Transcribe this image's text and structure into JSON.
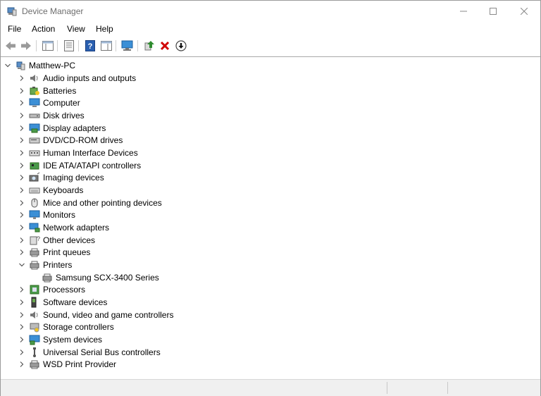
{
  "window": {
    "title": "Device Manager"
  },
  "menu": [
    "File",
    "Action",
    "View",
    "Help"
  ],
  "tree": {
    "root": "Matthew-PC",
    "categories": [
      {
        "label": "Audio inputs and outputs",
        "icon": "speaker-icon"
      },
      {
        "label": "Batteries",
        "icon": "battery-icon"
      },
      {
        "label": "Computer",
        "icon": "computer-icon"
      },
      {
        "label": "Disk drives",
        "icon": "disk-drive-icon"
      },
      {
        "label": "Display adapters",
        "icon": "display-adapter-icon"
      },
      {
        "label": "DVD/CD-ROM drives",
        "icon": "dvd-drive-icon"
      },
      {
        "label": "Human Interface Devices",
        "icon": "hid-icon"
      },
      {
        "label": "IDE ATA/ATAPI controllers",
        "icon": "ide-controller-icon"
      },
      {
        "label": "Imaging devices",
        "icon": "camera-icon"
      },
      {
        "label": "Keyboards",
        "icon": "keyboard-icon"
      },
      {
        "label": "Mice and other pointing devices",
        "icon": "mouse-icon"
      },
      {
        "label": "Monitors",
        "icon": "monitor-icon"
      },
      {
        "label": "Network adapters",
        "icon": "network-adapter-icon"
      },
      {
        "label": "Other devices",
        "icon": "unknown-device-icon"
      },
      {
        "label": "Print queues",
        "icon": "print-queue-icon"
      },
      {
        "label": "Printers",
        "icon": "printer-icon",
        "expanded": true,
        "children": [
          {
            "label": "Samsung SCX-3400 Series",
            "icon": "printer-icon"
          }
        ]
      },
      {
        "label": "Processors",
        "icon": "processor-icon"
      },
      {
        "label": "Software devices",
        "icon": "software-device-icon"
      },
      {
        "label": "Sound, video and game controllers",
        "icon": "sound-controller-icon"
      },
      {
        "label": "Storage controllers",
        "icon": "storage-controller-icon"
      },
      {
        "label": "System devices",
        "icon": "system-device-icon"
      },
      {
        "label": "Universal Serial Bus controllers",
        "icon": "usb-icon"
      },
      {
        "label": "WSD Print Provider",
        "icon": "wsd-printer-icon"
      }
    ]
  },
  "colors": {
    "selected": "#cce8ff",
    "accent_blue": "#1e7fd8",
    "toolbar_red": "#d00000",
    "toolbar_green": "#2e8b2e"
  }
}
